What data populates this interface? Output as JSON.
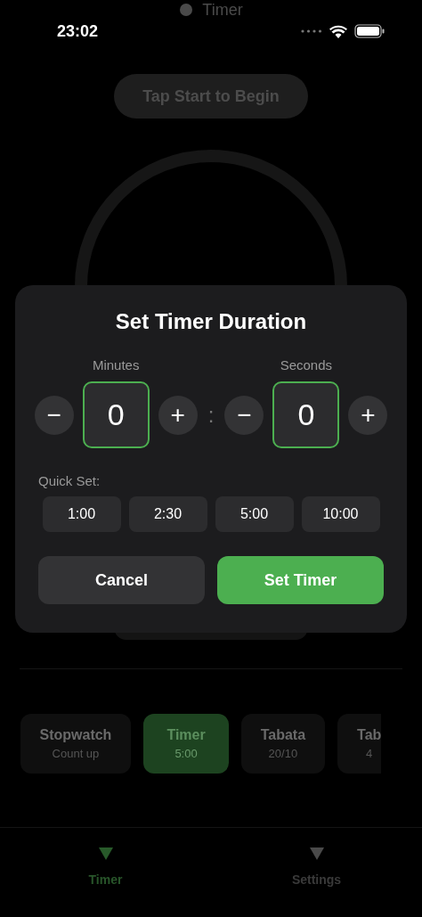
{
  "header": {
    "title": "Timer"
  },
  "status_bar": {
    "time": "23:02"
  },
  "banner": "Tap Start to Begin",
  "dialog": {
    "title": "Set Timer Duration",
    "fields": [
      {
        "label": "Minutes",
        "value": "0",
        "decrement": "−",
        "increment": "+"
      },
      {
        "label": "Seconds",
        "value": "0",
        "decrement": "−",
        "increment": "+"
      }
    ],
    "separator": ":",
    "quick_set": {
      "label": "Quick Set:",
      "options": [
        "1:00",
        "2:30",
        "5:00",
        "10:00"
      ]
    },
    "buttons": [
      {
        "label": "Cancel",
        "kind": "secondary"
      },
      {
        "label": "Set Timer",
        "kind": "primary"
      }
    ]
  },
  "modes": [
    {
      "title": "Stopwatch",
      "subtitle": "Count up",
      "selected": false
    },
    {
      "title": "Timer",
      "subtitle": "5:00",
      "selected": true
    },
    {
      "title": "Tabata",
      "subtitle": "20/10",
      "selected": false
    },
    {
      "title": "Tab",
      "subtitle": "4",
      "selected": false
    }
  ],
  "tab_bar": [
    {
      "label": "Timer",
      "selected": true
    },
    {
      "label": "Settings",
      "selected": false
    }
  ]
}
